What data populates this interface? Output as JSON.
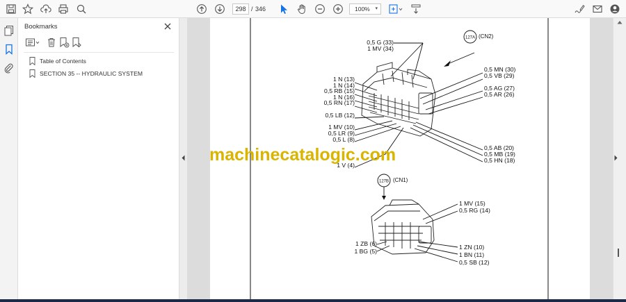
{
  "toolbar": {
    "page_current": "298",
    "page_separator": "/",
    "page_total": "346",
    "zoom": "100%"
  },
  "bookmarks": {
    "title": "Bookmarks",
    "items": [
      {
        "label": "Table of Contents"
      },
      {
        "label": "SECTION 35 -- HYDRAULIC SYSTEM"
      }
    ]
  },
  "document": {
    "watermark": "machinecatalogic.com",
    "connector_a": {
      "badge": "127A",
      "name": "(CN2)",
      "top_labels": [
        "0,5 G (33)",
        "1 MV (34)"
      ],
      "left_labels": [
        "1 N (13)",
        "1 N (14)",
        "0,5 RB (15)",
        "1 N (16)",
        "0,5 RN (17)",
        "0,5 LB (12)",
        "1 MV (10)",
        "0,5 LR (9)",
        "0,5 L (8)",
        "1 V (4)"
      ],
      "right_labels": [
        "0,5 MN (30)",
        "0,5 VB (29)",
        "0,5 AG (27)",
        "0,5 AR (26)",
        "0,5 AB (20)",
        "0,5 MB (19)",
        "0,5 HN (18)"
      ]
    },
    "connector_b": {
      "badge": "127B",
      "name": "(CN1)",
      "right_top_labels": [
        "1 MV (15)",
        "0,5 RG (14)"
      ],
      "left_labels": [
        "1 ZB (6)",
        "1 BG (5)"
      ],
      "right_bottom_labels": [
        "1 ZN (10)",
        "1 BN (11)",
        "0,5 SB (12)"
      ]
    }
  },
  "icons": [
    "save-icon",
    "bookmark-star-icon",
    "upload-icon",
    "print-icon",
    "zoom-search-icon",
    "prev-page-icon",
    "next-page-icon",
    "select-cursor-icon",
    "hand-icon",
    "zoom-out-icon",
    "zoom-in-icon",
    "fit-page-icon",
    "scroll-mode-icon",
    "sign-icon",
    "email-icon",
    "account-icon"
  ],
  "colors": {
    "watermark": "#d9b400",
    "select_tool_active": "#1473e6",
    "bottom_bar": "#1c2a4a"
  }
}
